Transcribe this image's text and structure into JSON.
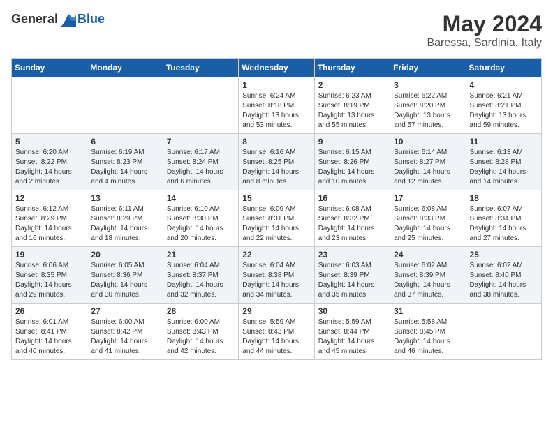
{
  "header": {
    "logo_general": "General",
    "logo_blue": "Blue",
    "month": "May 2024",
    "location": "Baressa, Sardinia, Italy"
  },
  "days_of_week": [
    "Sunday",
    "Monday",
    "Tuesday",
    "Wednesday",
    "Thursday",
    "Friday",
    "Saturday"
  ],
  "weeks": [
    [
      {
        "day": "",
        "sunrise": "",
        "sunset": "",
        "daylight": ""
      },
      {
        "day": "",
        "sunrise": "",
        "sunset": "",
        "daylight": ""
      },
      {
        "day": "",
        "sunrise": "",
        "sunset": "",
        "daylight": ""
      },
      {
        "day": "1",
        "sunrise": "Sunrise: 6:24 AM",
        "sunset": "Sunset: 8:18 PM",
        "daylight": "Daylight: 13 hours and 53 minutes."
      },
      {
        "day": "2",
        "sunrise": "Sunrise: 6:23 AM",
        "sunset": "Sunset: 8:19 PM",
        "daylight": "Daylight: 13 hours and 55 minutes."
      },
      {
        "day": "3",
        "sunrise": "Sunrise: 6:22 AM",
        "sunset": "Sunset: 8:20 PM",
        "daylight": "Daylight: 13 hours and 57 minutes."
      },
      {
        "day": "4",
        "sunrise": "Sunrise: 6:21 AM",
        "sunset": "Sunset: 8:21 PM",
        "daylight": "Daylight: 13 hours and 59 minutes."
      }
    ],
    [
      {
        "day": "5",
        "sunrise": "Sunrise: 6:20 AM",
        "sunset": "Sunset: 8:22 PM",
        "daylight": "Daylight: 14 hours and 2 minutes."
      },
      {
        "day": "6",
        "sunrise": "Sunrise: 6:19 AM",
        "sunset": "Sunset: 8:23 PM",
        "daylight": "Daylight: 14 hours and 4 minutes."
      },
      {
        "day": "7",
        "sunrise": "Sunrise: 6:17 AM",
        "sunset": "Sunset: 8:24 PM",
        "daylight": "Daylight: 14 hours and 6 minutes."
      },
      {
        "day": "8",
        "sunrise": "Sunrise: 6:16 AM",
        "sunset": "Sunset: 8:25 PM",
        "daylight": "Daylight: 14 hours and 8 minutes."
      },
      {
        "day": "9",
        "sunrise": "Sunrise: 6:15 AM",
        "sunset": "Sunset: 8:26 PM",
        "daylight": "Daylight: 14 hours and 10 minutes."
      },
      {
        "day": "10",
        "sunrise": "Sunrise: 6:14 AM",
        "sunset": "Sunset: 8:27 PM",
        "daylight": "Daylight: 14 hours and 12 minutes."
      },
      {
        "day": "11",
        "sunrise": "Sunrise: 6:13 AM",
        "sunset": "Sunset: 8:28 PM",
        "daylight": "Daylight: 14 hours and 14 minutes."
      }
    ],
    [
      {
        "day": "12",
        "sunrise": "Sunrise: 6:12 AM",
        "sunset": "Sunset: 8:29 PM",
        "daylight": "Daylight: 14 hours and 16 minutes."
      },
      {
        "day": "13",
        "sunrise": "Sunrise: 6:11 AM",
        "sunset": "Sunset: 8:29 PM",
        "daylight": "Daylight: 14 hours and 18 minutes."
      },
      {
        "day": "14",
        "sunrise": "Sunrise: 6:10 AM",
        "sunset": "Sunset: 8:30 PM",
        "daylight": "Daylight: 14 hours and 20 minutes."
      },
      {
        "day": "15",
        "sunrise": "Sunrise: 6:09 AM",
        "sunset": "Sunset: 8:31 PM",
        "daylight": "Daylight: 14 hours and 22 minutes."
      },
      {
        "day": "16",
        "sunrise": "Sunrise: 6:08 AM",
        "sunset": "Sunset: 8:32 PM",
        "daylight": "Daylight: 14 hours and 23 minutes."
      },
      {
        "day": "17",
        "sunrise": "Sunrise: 6:08 AM",
        "sunset": "Sunset: 8:33 PM",
        "daylight": "Daylight: 14 hours and 25 minutes."
      },
      {
        "day": "18",
        "sunrise": "Sunrise: 6:07 AM",
        "sunset": "Sunset: 8:34 PM",
        "daylight": "Daylight: 14 hours and 27 minutes."
      }
    ],
    [
      {
        "day": "19",
        "sunrise": "Sunrise: 6:06 AM",
        "sunset": "Sunset: 8:35 PM",
        "daylight": "Daylight: 14 hours and 29 minutes."
      },
      {
        "day": "20",
        "sunrise": "Sunrise: 6:05 AM",
        "sunset": "Sunset: 8:36 PM",
        "daylight": "Daylight: 14 hours and 30 minutes."
      },
      {
        "day": "21",
        "sunrise": "Sunrise: 6:04 AM",
        "sunset": "Sunset: 8:37 PM",
        "daylight": "Daylight: 14 hours and 32 minutes."
      },
      {
        "day": "22",
        "sunrise": "Sunrise: 6:04 AM",
        "sunset": "Sunset: 8:38 PM",
        "daylight": "Daylight: 14 hours and 34 minutes."
      },
      {
        "day": "23",
        "sunrise": "Sunrise: 6:03 AM",
        "sunset": "Sunset: 8:39 PM",
        "daylight": "Daylight: 14 hours and 35 minutes."
      },
      {
        "day": "24",
        "sunrise": "Sunrise: 6:02 AM",
        "sunset": "Sunset: 8:39 PM",
        "daylight": "Daylight: 14 hours and 37 minutes."
      },
      {
        "day": "25",
        "sunrise": "Sunrise: 6:02 AM",
        "sunset": "Sunset: 8:40 PM",
        "daylight": "Daylight: 14 hours and 38 minutes."
      }
    ],
    [
      {
        "day": "26",
        "sunrise": "Sunrise: 6:01 AM",
        "sunset": "Sunset: 8:41 PM",
        "daylight": "Daylight: 14 hours and 40 minutes."
      },
      {
        "day": "27",
        "sunrise": "Sunrise: 6:00 AM",
        "sunset": "Sunset: 8:42 PM",
        "daylight": "Daylight: 14 hours and 41 minutes."
      },
      {
        "day": "28",
        "sunrise": "Sunrise: 6:00 AM",
        "sunset": "Sunset: 8:43 PM",
        "daylight": "Daylight: 14 hours and 42 minutes."
      },
      {
        "day": "29",
        "sunrise": "Sunrise: 5:59 AM",
        "sunset": "Sunset: 8:43 PM",
        "daylight": "Daylight: 14 hours and 44 minutes."
      },
      {
        "day": "30",
        "sunrise": "Sunrise: 5:59 AM",
        "sunset": "Sunset: 8:44 PM",
        "daylight": "Daylight: 14 hours and 45 minutes."
      },
      {
        "day": "31",
        "sunrise": "Sunrise: 5:58 AM",
        "sunset": "Sunset: 8:45 PM",
        "daylight": "Daylight: 14 hours and 46 minutes."
      },
      {
        "day": "",
        "sunrise": "",
        "sunset": "",
        "daylight": ""
      }
    ]
  ]
}
